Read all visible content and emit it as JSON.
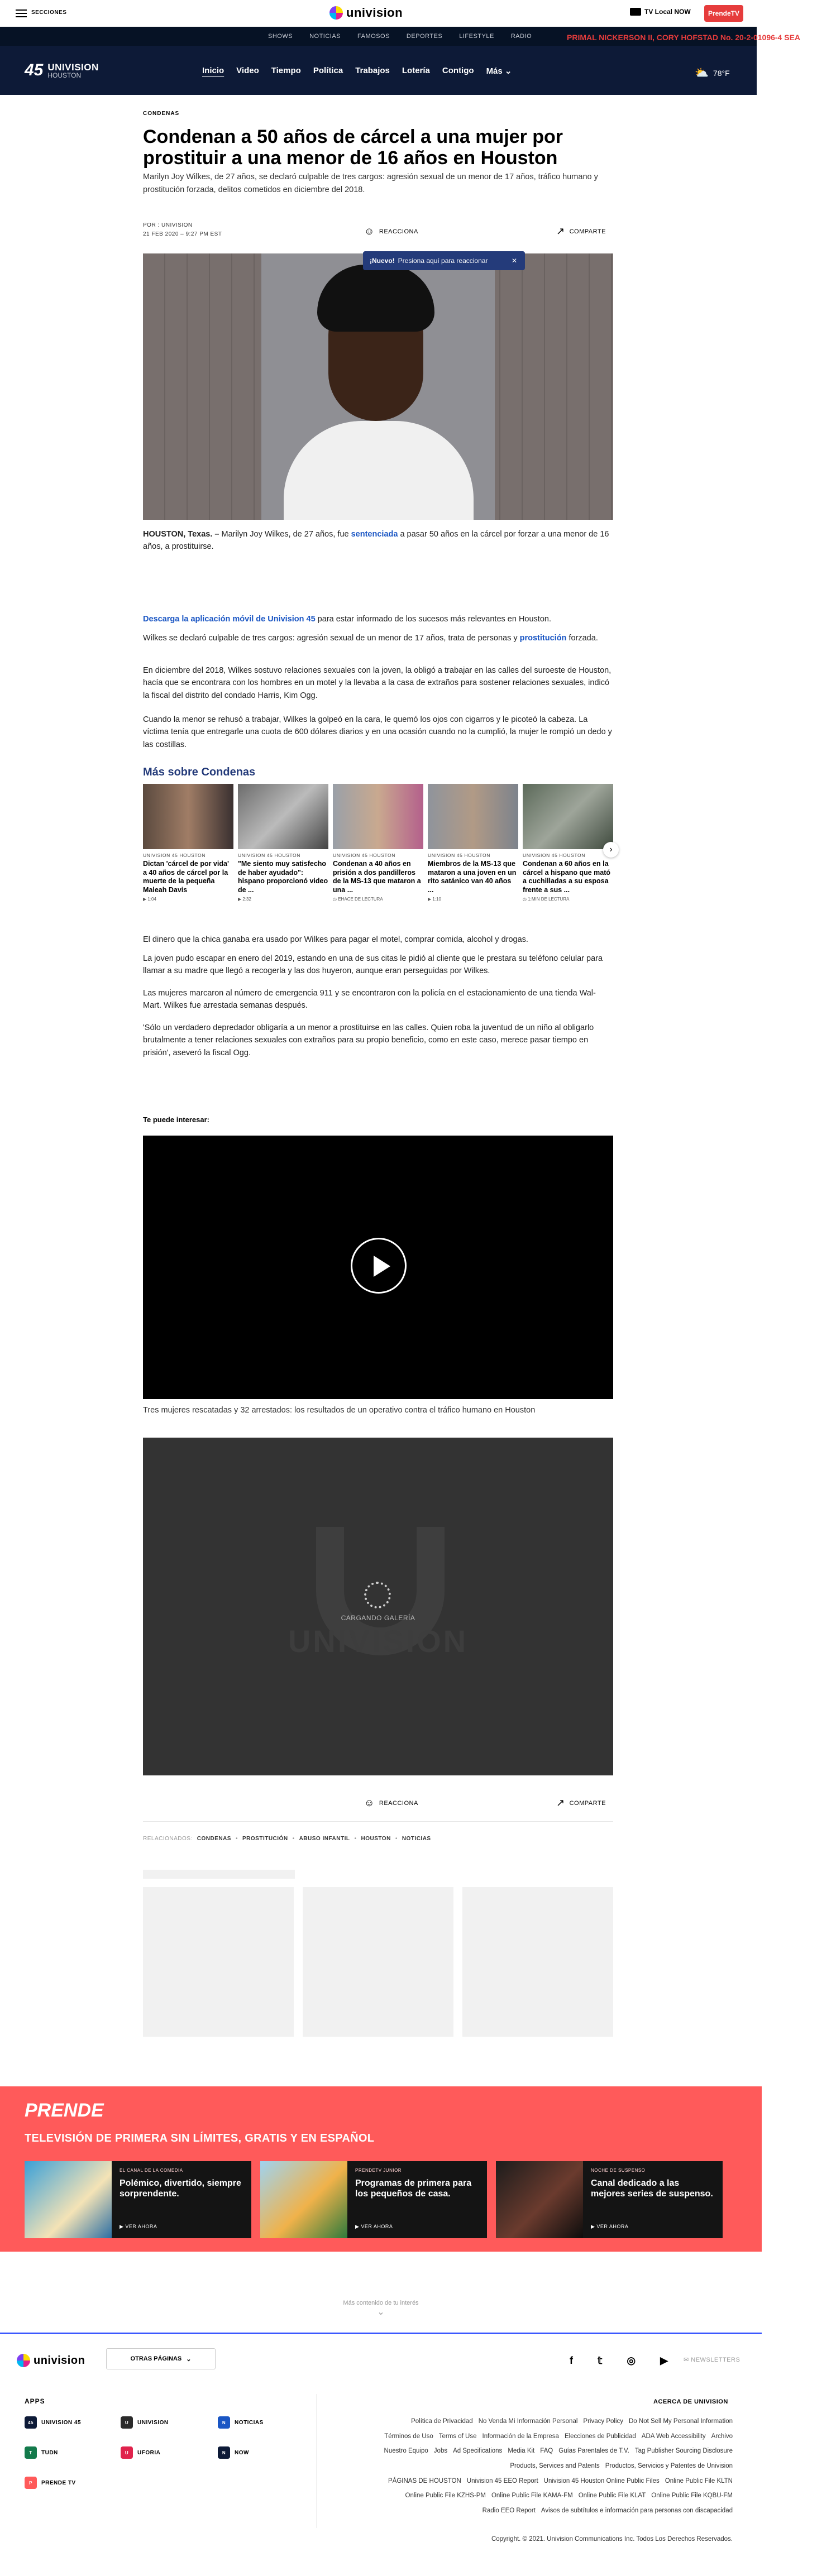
{
  "topbar": {
    "sections_label": "SECCIONES",
    "brand": "univision",
    "tv_local": "TV Local NOW",
    "prende": "PrendeTV"
  },
  "nav": {
    "items": [
      "SHOWS",
      "NOTICIAS",
      "FAMOSOS",
      "DEPORTES",
      "LIFESTYLE",
      "RADIO"
    ],
    "ticker": "PRIMAL NICKERSON II, CORY HOFSTAD No. 20-2-01096-4 SEA"
  },
  "station": {
    "number": "45",
    "name": "UNIVISION",
    "city": "HOUSTON",
    "menu": [
      "Inicio",
      "Video",
      "Tiempo",
      "Política",
      "Trabajos",
      "Lotería",
      "Contigo",
      "Más"
    ],
    "temperature": "78°F"
  },
  "article": {
    "kicker": "CONDENAS",
    "headline": "Condenan a 50 años de cárcel a una mujer por prostituir a una menor de 16 años en Houston",
    "dek": "Marilyn Joy Wilkes, de 27 años, se declaró culpable de tres cargos: agresión sexual de un menor de 17 años, tráfico humano y prostitución forzada, delitos cometidos en diciembre del 2018.",
    "byline_author": "POR : UNIVISION",
    "byline_date": "21 FEB 2020 – 9:27 PM EST",
    "react_label": "REACCIONA",
    "share_label": "COMPARTE",
    "tooltip_bold": "¡Nuevo!",
    "tooltip_text": "Presiona aquí para reaccionar",
    "p1_lead": "HOUSTON, Texas. –",
    "p1_a": " Marilyn Joy Wilkes, de 27 años, fue ",
    "p1_link": "sentenciada",
    "p1_b": " a pasar 50 años en la cárcel por forzar a una menor de 16 años, a prostituirse.",
    "app_link": "Descarga la aplicación móvil de Univision 45",
    "app_rest": " para estar informado de los sucesos más relevantes en Houston.",
    "p2_a": "Wilkes se declaró culpable de tres cargos: agresión sexual de un menor de 17 años, trata de personas y ",
    "p2_link": "prostitución",
    "p2_b": " forzada.",
    "p3": "En diciembre del 2018, Wilkes sostuvo relaciones sexuales con la joven, la obligó a trabajar en las calles del suroeste de Houston, hacía que se encontrara con los hombres en un motel y la llevaba a la casa de extraños para sostener relaciones sexuales, indicó la fiscal del distrito del condado Harris, Kim Ogg.",
    "p4": "Cuando la menor se rehusó a trabajar, Wilkes la golpeó en la cara, le quemó los ojos con cigarros y le picoteó la cabeza. La víctima tenía que entregarle una cuota de 600 dólares diarios y en una ocasión cuando no la cumplió, la mujer le rompió un dedo y las costillas.",
    "p5": "El dinero que la chica ganaba era usado por Wilkes para pagar el motel, comprar comida, alcohol y drogas.",
    "p6": "La joven pudo escapar en enero del 2019, estando en una de sus citas le pidió al cliente que le prestara su teléfono celular para llamar a su madre que llegó a recogerla y las dos huyeron, aunque eran perseguidas por Wilkes.",
    "p7": "Las mujeres marcaron al número de emergencia 911 y se encontraron con la policía en el estacionamiento de una tienda Wal-Mart. Wilkes fue arrestada semanas después.",
    "p8": "'Sólo un verdadero depredador obligaría a un menor a prostituirse en las calles. Quien roba la juventud de un niño al obligarlo brutalmente a tener relaciones sexuales con extraños para su propio beneficio, como en este caso, merece pasar tiempo en prisión', aseveró la fiscal Ogg."
  },
  "related": {
    "title": "Más sobre Condenas",
    "cards": [
      {
        "source": "UNIVISION 45 HOUSTON",
        "title": "Dictan 'cárcel de por vida' a 40 años de cárcel por la muerte de la pequeña Maleah Davis",
        "meta": "1:04"
      },
      {
        "source": "UNIVISION 45 HOUSTON",
        "title": "\"Me siento muy satisfecho de haber ayudado\": hispano proporcionó video de ...",
        "meta": "2:32"
      },
      {
        "source": "UNIVISION 45 HOUSTON",
        "title": "Condenan a 40 años en prisión a dos pandilleros de la MS-13 que mataron a una ...",
        "meta": "EHACE DE LECTURA"
      },
      {
        "source": "UNIVISION 45 HOUSTON",
        "title": "Miembros de la MS-13 que mataron a una joven en un rito satánico van 40 años ...",
        "meta": "1:10"
      },
      {
        "source": "UNIVISION 45 HOUSTON",
        "title": "Condenan a 60 años en la cárcel a hispano que mató a cuchilladas a su esposa frente a sus ...",
        "meta": "1:MIN DE LECTURA"
      }
    ]
  },
  "video": {
    "interes": "Te puede interesar:",
    "caption": "Tres mujeres rescatadas y 32 arrestados: los resultados de un operativo contra el tráfico humano en Houston",
    "gallery_loading": "CARGANDO GALERÍA",
    "gallery_watermark": "UNIVISION"
  },
  "tags": {
    "label": "RELACIONADOS:",
    "items": [
      "CONDENAS",
      "PROSTITUCIÓN",
      "ABUSO INFANTIL",
      "HOUSTON",
      "NOTICIAS"
    ]
  },
  "prende": {
    "logo": "PRENDE",
    "tagline": "TELEVISIÓN DE PRIMERA SIN LÍMITES, GRATIS Y EN ESPAÑOL",
    "cards": [
      {
        "channel": "EL CANAL DE LA COMEDIA",
        "title": "Polémico, divertido, siempre sorprendente.",
        "watch": "VER AHORA"
      },
      {
        "channel": "PRENDETV JUNIOR",
        "title": "Programas de primera para los pequeños de casa.",
        "watch": "VER AHORA"
      },
      {
        "channel": "NOCHE DE SUSPENSO",
        "title": "Canal dedicado a las mejores series de suspenso.",
        "watch": "VER AHORA"
      }
    ]
  },
  "more_loading": "Más contenido de tu interés",
  "footer": {
    "brand": "univision",
    "dropdown": "OTRAS PÁGINAS",
    "newsletter": "NEWSLETTERS",
    "apps_title": "APPS",
    "apps": [
      {
        "name": "UNIVISION 45",
        "color": "#0d1a37"
      },
      {
        "name": "UNIVISION",
        "color": "#2a2a2a"
      },
      {
        "name": "NOTICIAS",
        "color": "#1a56c4"
      },
      {
        "name": "TUDN",
        "color": "#137a4b"
      },
      {
        "name": "UFORIA",
        "color": "#e0224c"
      },
      {
        "name": "NOW",
        "color": "#0d1a37"
      },
      {
        "name": "PRENDE TV",
        "color": "#ff5a5a"
      }
    ],
    "acerca": "ACERCA DE UNIVISION",
    "link_rows": [
      [
        "Política de Privacidad",
        "No Venda Mi Información Personal",
        "Privacy Policy",
        "Do Not Sell My Personal Information"
      ],
      [
        "Términos de Uso",
        "Terms of Use",
        "Información de la Empresa",
        "Elecciones de Publicidad",
        "ADA Web Accessibility",
        "Archivo"
      ],
      [
        "Nuestro Equipo",
        "Jobs",
        "Ad Specifications",
        "Media Kit",
        "FAQ",
        "Guías Parentales de T.V.",
        "Tag Publisher Sourcing Disclosure"
      ],
      [
        "Products, Services and Patents",
        "Productos, Servicios y Patentes de Univision"
      ],
      [
        "PÁGINAS DE HOUSTON",
        "Univision 45 EEO Report",
        "Univision 45 Houston Online Public Files",
        "Online Public File KLTN"
      ],
      [
        "Online Public File KZHS-PM",
        "Online Public File KAMA-FM",
        "Online Public File KLAT",
        "Online Public File KQBU-FM"
      ],
      [
        "Radio EEO Report",
        "Avisos de subtítulos e información para personas con discapacidad"
      ]
    ],
    "copyright": "Copyright. © 2021. Univision Communications Inc. Todos Los Derechos Reservados."
  }
}
